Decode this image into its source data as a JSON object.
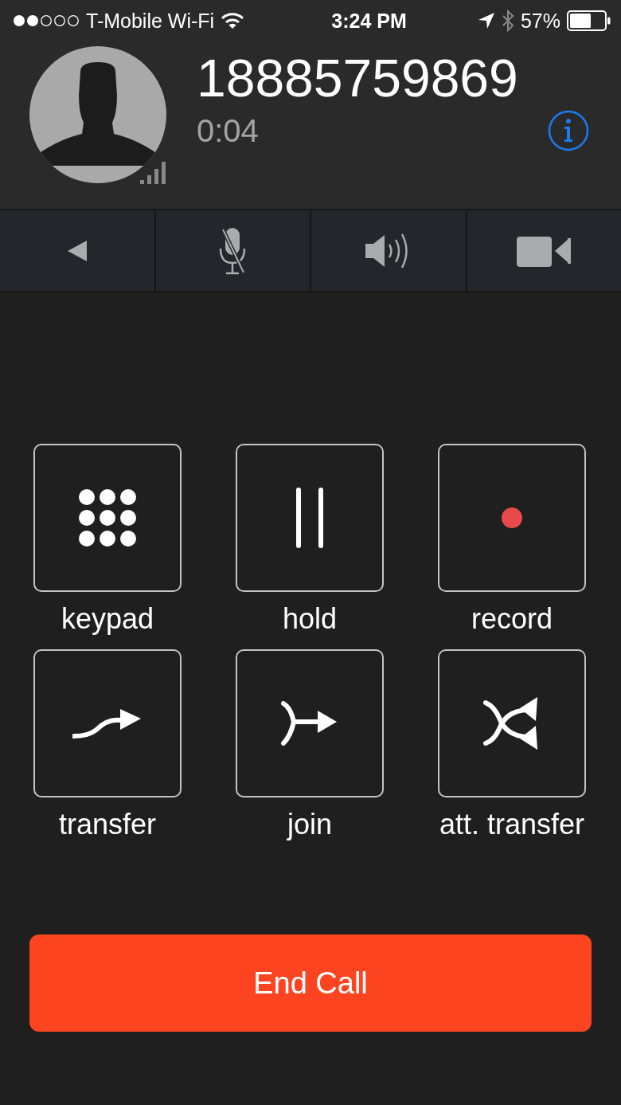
{
  "status_bar": {
    "carrier": "T-Mobile Wi-Fi",
    "time": "3:24 PM",
    "battery": "57%"
  },
  "call": {
    "number": "18885759869",
    "duration": "0:04"
  },
  "toolbar": [
    {
      "kind": "back"
    },
    {
      "kind": "mute"
    },
    {
      "kind": "speaker"
    },
    {
      "kind": "video"
    }
  ],
  "actions": [
    {
      "kind": "keypad",
      "label": "keypad"
    },
    {
      "kind": "hold",
      "label": "hold"
    },
    {
      "kind": "record",
      "label": "record"
    },
    {
      "kind": "transfer",
      "label": "transfer"
    },
    {
      "kind": "join",
      "label": "join"
    },
    {
      "kind": "att-transfer",
      "label": "att. transfer"
    }
  ],
  "end_button": "End Call"
}
